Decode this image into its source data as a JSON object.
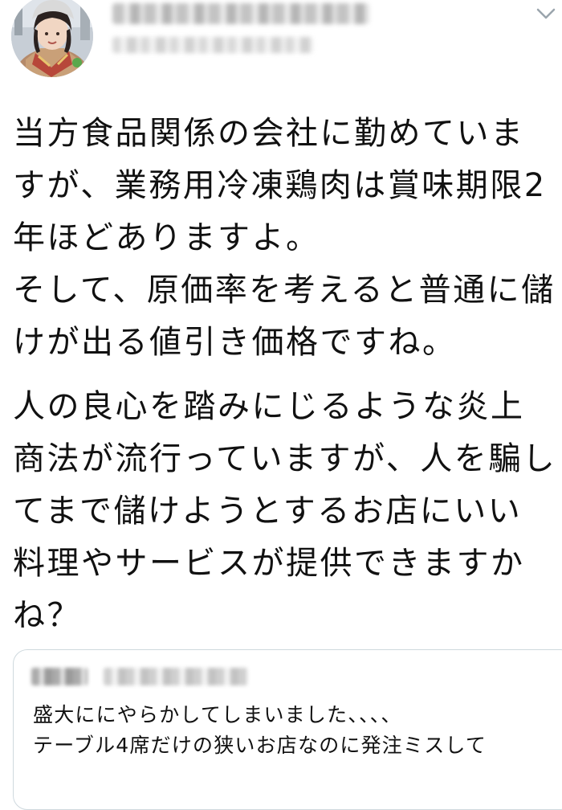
{
  "tweet": {
    "body": {
      "paragraph1": [
        "当方食品関係の会社に勤めていま",
        "すが、業務用冷凍鶏肉は賞味期限2",
        "年ほどありますよ。",
        "そして、原価率を考えると普通に儲",
        "けが出る値引き価格ですね。"
      ],
      "paragraph2": [
        "人の良心を踏みにじるような炎上",
        "商法が流行っていますが、人を騙し",
        "てまで儲けようとするお店にいい",
        "料理やサービスが提供できますか",
        "ね？"
      ]
    },
    "quoted": {
      "lines": [
        "盛大ににやらかしてしまいました、、、、",
        "テーブル4席だけの狭いお店なのに発注ミスして"
      ]
    }
  },
  "icons": {
    "avatar": "profile-photo",
    "menu": "chevron-down-icon"
  },
  "colors": {
    "text": "#111111",
    "quote_border": "#cfd9de",
    "chevron": "#9aa5ad"
  }
}
